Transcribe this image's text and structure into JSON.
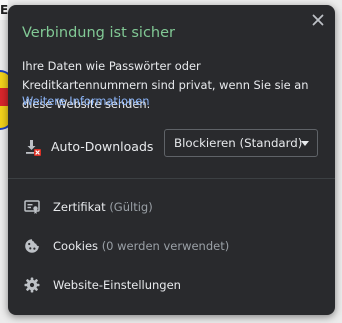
{
  "backdrop": {
    "tab_char": "E"
  },
  "popup": {
    "title": "Verbindung ist sicher",
    "description": "Ihre Daten wie Passwörter oder Kreditkartennummern sind privat, wenn Sie sie an diese Website senden.",
    "more_info_link": "Weitere Informationen",
    "close_icon": "close-icon",
    "title_color": "#81c995",
    "link_color": "#8ab4f8"
  },
  "permission": {
    "icon": "download-blocked-icon",
    "label": "Auto-Downloads",
    "selected_value": "Blockieren (Standard)"
  },
  "menu": [
    {
      "icon": "certificate-icon",
      "label": "Zertifikat",
      "sub": "(Gültig)"
    },
    {
      "icon": "cookie-icon",
      "label": "Cookies",
      "sub": "(0 werden verwendet)"
    },
    {
      "icon": "gear-icon",
      "label": "Website-Einstellungen",
      "sub": ""
    }
  ]
}
